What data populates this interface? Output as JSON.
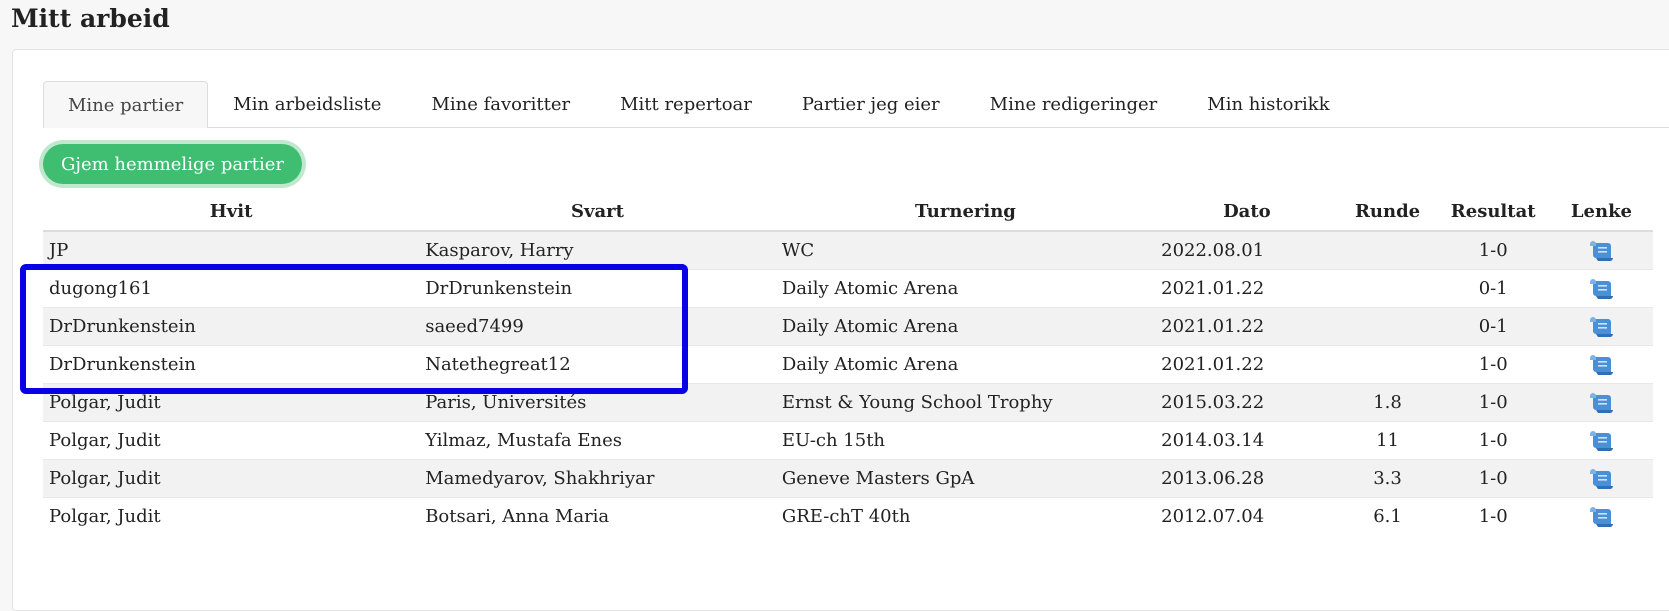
{
  "page": {
    "title": "Mitt arbeid"
  },
  "tabs": [
    {
      "label": "Mine partier"
    },
    {
      "label": "Min arbeidsliste"
    },
    {
      "label": "Mine favoritter"
    },
    {
      "label": "Mitt repertoar"
    },
    {
      "label": "Partier jeg eier"
    },
    {
      "label": "Mine redigeringer"
    },
    {
      "label": "Min historikk"
    }
  ],
  "toggle_button": {
    "label": "Gjem hemmelige partier"
  },
  "table": {
    "headers": {
      "white": "Hvit",
      "black": "Svart",
      "tournament": "Turnering",
      "date": "Dato",
      "round": "Runde",
      "result": "Resultat",
      "link": "Lenke"
    },
    "rows": [
      {
        "white": "JP",
        "black": "Kasparov, Harry",
        "tournament": "WC",
        "date": "2022.08.01",
        "round": "",
        "result": "1-0",
        "link_icon": "scroll-icon"
      },
      {
        "white": "dugong161",
        "black": "DrDrunkenstein",
        "tournament": "Daily Atomic Arena",
        "date": "2021.01.22",
        "round": "",
        "result": "0-1",
        "link_icon": "scroll-icon"
      },
      {
        "white": "DrDrunkenstein",
        "black": "saeed7499",
        "tournament": "Daily Atomic Arena",
        "date": "2021.01.22",
        "round": "",
        "result": "0-1",
        "link_icon": "scroll-icon"
      },
      {
        "white": "DrDrunkenstein",
        "black": "Natethegreat12",
        "tournament": "Daily Atomic Arena",
        "date": "2021.01.22",
        "round": "",
        "result": "1-0",
        "link_icon": "scroll-icon"
      },
      {
        "white": "Polgar, Judit",
        "black": "Paris, Universités",
        "tournament": "Ernst & Young School Trophy",
        "date": "2015.03.22",
        "round": "1.8",
        "result": "1-0",
        "link_icon": "scroll-icon"
      },
      {
        "white": "Polgar, Judit",
        "black": "Yilmaz, Mustafa Enes",
        "tournament": "EU-ch 15th",
        "date": "2014.03.14",
        "round": "11",
        "result": "1-0",
        "link_icon": "scroll-icon"
      },
      {
        "white": "Polgar, Judit",
        "black": "Mamedyarov, Shakhriyar",
        "tournament": "Geneve Masters GpA",
        "date": "2013.06.28",
        "round": "3.3",
        "result": "1-0",
        "link_icon": "scroll-icon"
      },
      {
        "white": "Polgar, Judit",
        "black": "Botsari, Anna Maria",
        "tournament": "GRE-chT 40th",
        "date": "2012.07.04",
        "round": "6.1",
        "result": "1-0",
        "link_icon": "scroll-icon"
      }
    ]
  },
  "colors": {
    "accent_green": "#3fbe72",
    "highlight_blue": "#0a00e6",
    "icon_blue": "#4a90d9"
  }
}
